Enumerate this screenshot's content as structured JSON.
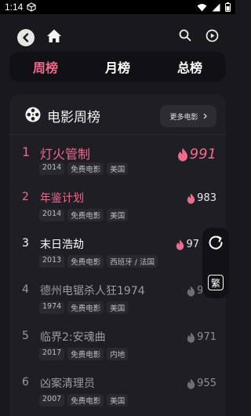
{
  "status_bar": {
    "time": "1:14"
  },
  "tabs": [
    {
      "label": "周榜",
      "active": true
    },
    {
      "label": "月榜",
      "active": false
    },
    {
      "label": "总榜",
      "active": false
    }
  ],
  "section": {
    "title": "电影周榜",
    "more_label": "更多电影"
  },
  "movies": [
    {
      "rank": "1",
      "title": "灯火管制",
      "tags": [
        "2014",
        "免费电影",
        "美国"
      ],
      "score": "991"
    },
    {
      "rank": "2",
      "title": "年鉴计划",
      "tags": [
        "2014",
        "免费电影",
        "美国"
      ],
      "score": "983"
    },
    {
      "rank": "3",
      "title": "末日浩劫",
      "tags": [
        "2013",
        "免费电影",
        "西班牙 / 法国"
      ],
      "score": "97"
    },
    {
      "rank": "4",
      "title": "德州电锯杀人狂1974",
      "tags": [
        "1974",
        "免费电影",
        "美国"
      ],
      "score": "975"
    },
    {
      "rank": "5",
      "title": "临界2:安魂曲",
      "tags": [
        "2017",
        "免费电影",
        "内地"
      ],
      "score": "971"
    },
    {
      "rank": "6",
      "title": "凶案清理员",
      "tags": [
        "2007",
        "免费电影",
        "美国"
      ],
      "score": "955"
    }
  ],
  "floating": {
    "traditional_label": "繁"
  },
  "colors": {
    "accent": "#f06a8c",
    "background": "#19181d",
    "card": "#1f1e24"
  }
}
